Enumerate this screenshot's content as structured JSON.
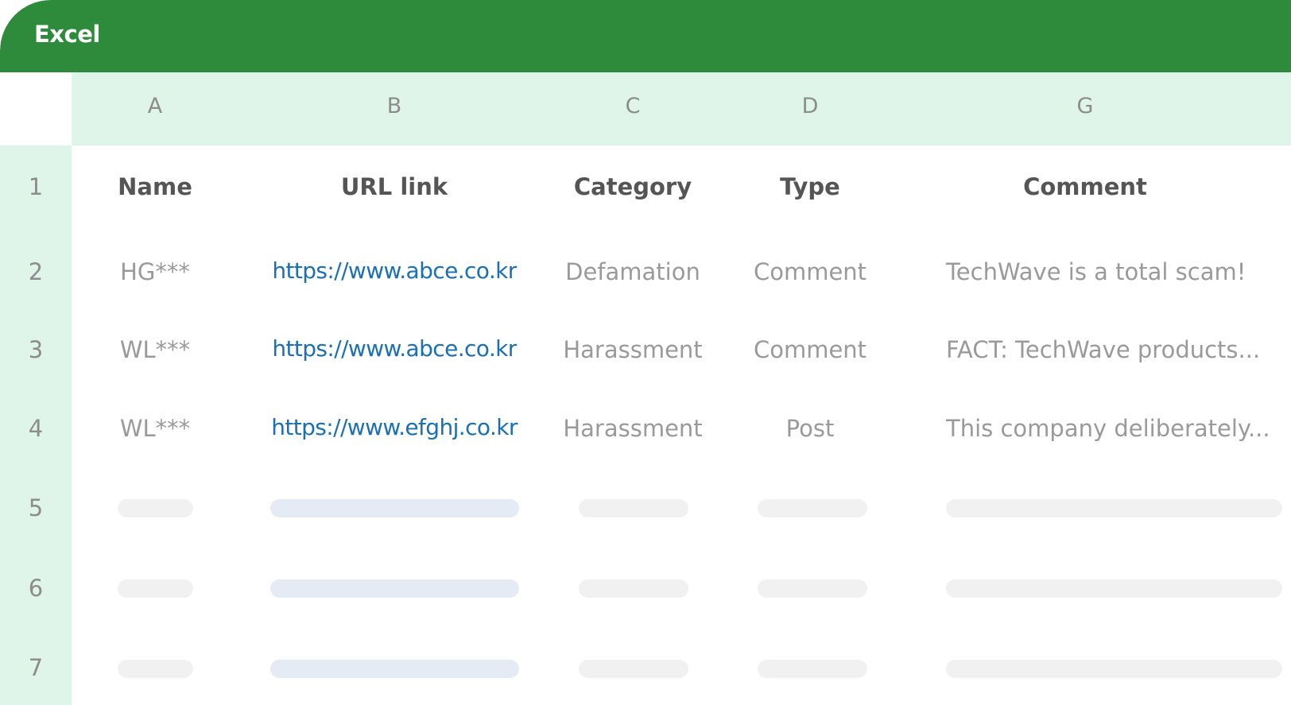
{
  "app": {
    "title": "Excel"
  },
  "columns": [
    "A",
    "B",
    "C",
    "D",
    "G"
  ],
  "row_numbers": [
    "1",
    "2",
    "3",
    "4",
    "5",
    "6",
    "7"
  ],
  "header_row": {
    "name": "Name",
    "url": "URL link",
    "category": "Category",
    "type": "Type",
    "comment": "Comment"
  },
  "rows": [
    {
      "name": "HG***",
      "url": "https://www.abce.co.kr",
      "category": "Defamation",
      "type": "Comment",
      "comment": "TechWave is a total scam!"
    },
    {
      "name": "WL***",
      "url": "https://www.abce.co.kr",
      "category": "Harassment",
      "type": "Comment",
      "comment": "FACT: TechWave products..."
    },
    {
      "name": "WL***",
      "url": "https://www.efghj.co.kr",
      "category": "Harassment",
      "type": "Post",
      "comment": "This company deliberately..."
    }
  ],
  "colors": {
    "titlebar": "#2e8b3c",
    "header_background": "#e0f5e9",
    "link": "#1a6fb5",
    "placeholder": "#f1f1f1",
    "placeholder_link": "#e4ebf5"
  }
}
